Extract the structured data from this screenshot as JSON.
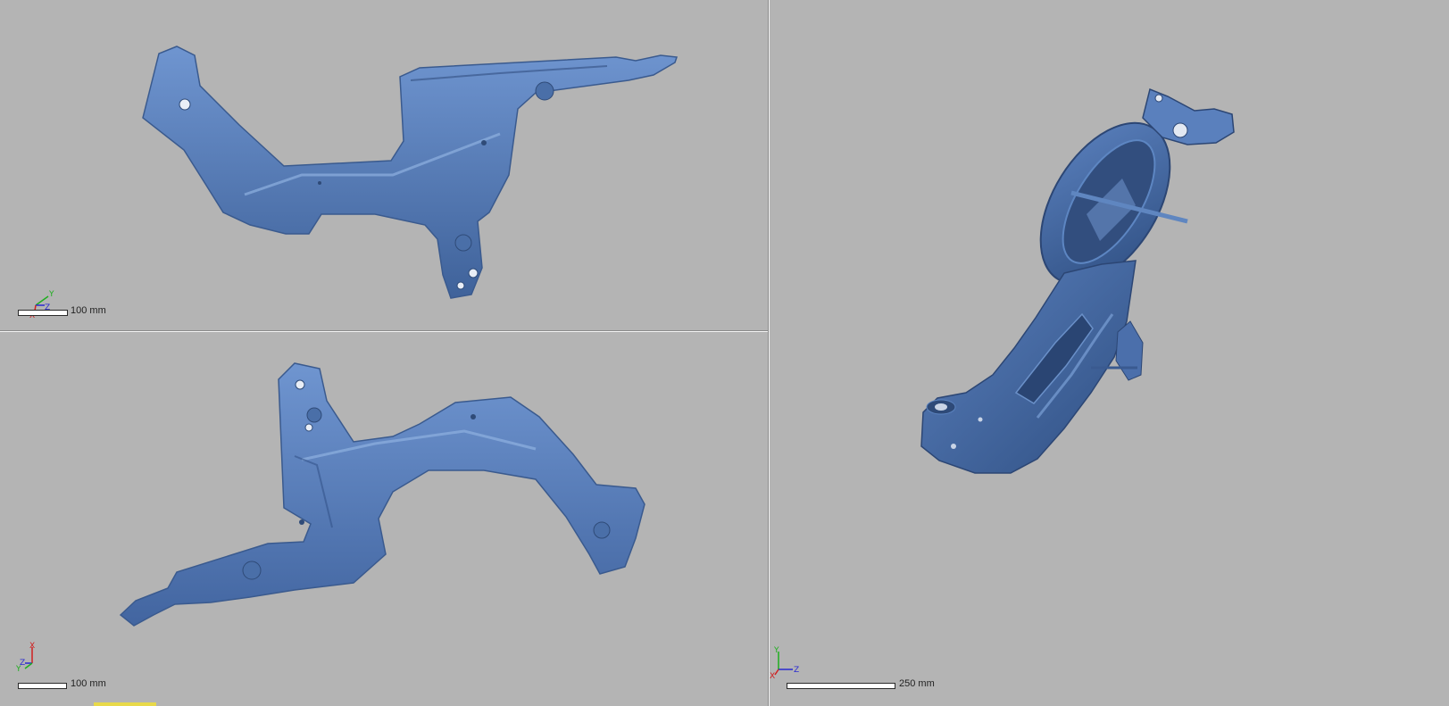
{
  "viewports": {
    "top": {
      "scale_label": "100 mm",
      "axes": {
        "a": "Y",
        "b": "Z",
        "c": "X"
      }
    },
    "bottom": {
      "scale_label": "100 mm",
      "axes": {
        "a": "X",
        "b": "Z",
        "c": "Y"
      }
    },
    "right": {
      "scale_label": "250 mm",
      "axes": {
        "a": "Y",
        "b": "Z",
        "c": "X"
      }
    }
  },
  "colors": {
    "background": "#b4b4b4",
    "model_blue": "#5b82bf",
    "model_dark": "#3c5f95",
    "axis_x": "#d02020",
    "axis_y": "#1fae1f",
    "axis_z": "#2a2ad0"
  },
  "icons": [
    "axis-triad-icon",
    "scale-bar-icon"
  ]
}
